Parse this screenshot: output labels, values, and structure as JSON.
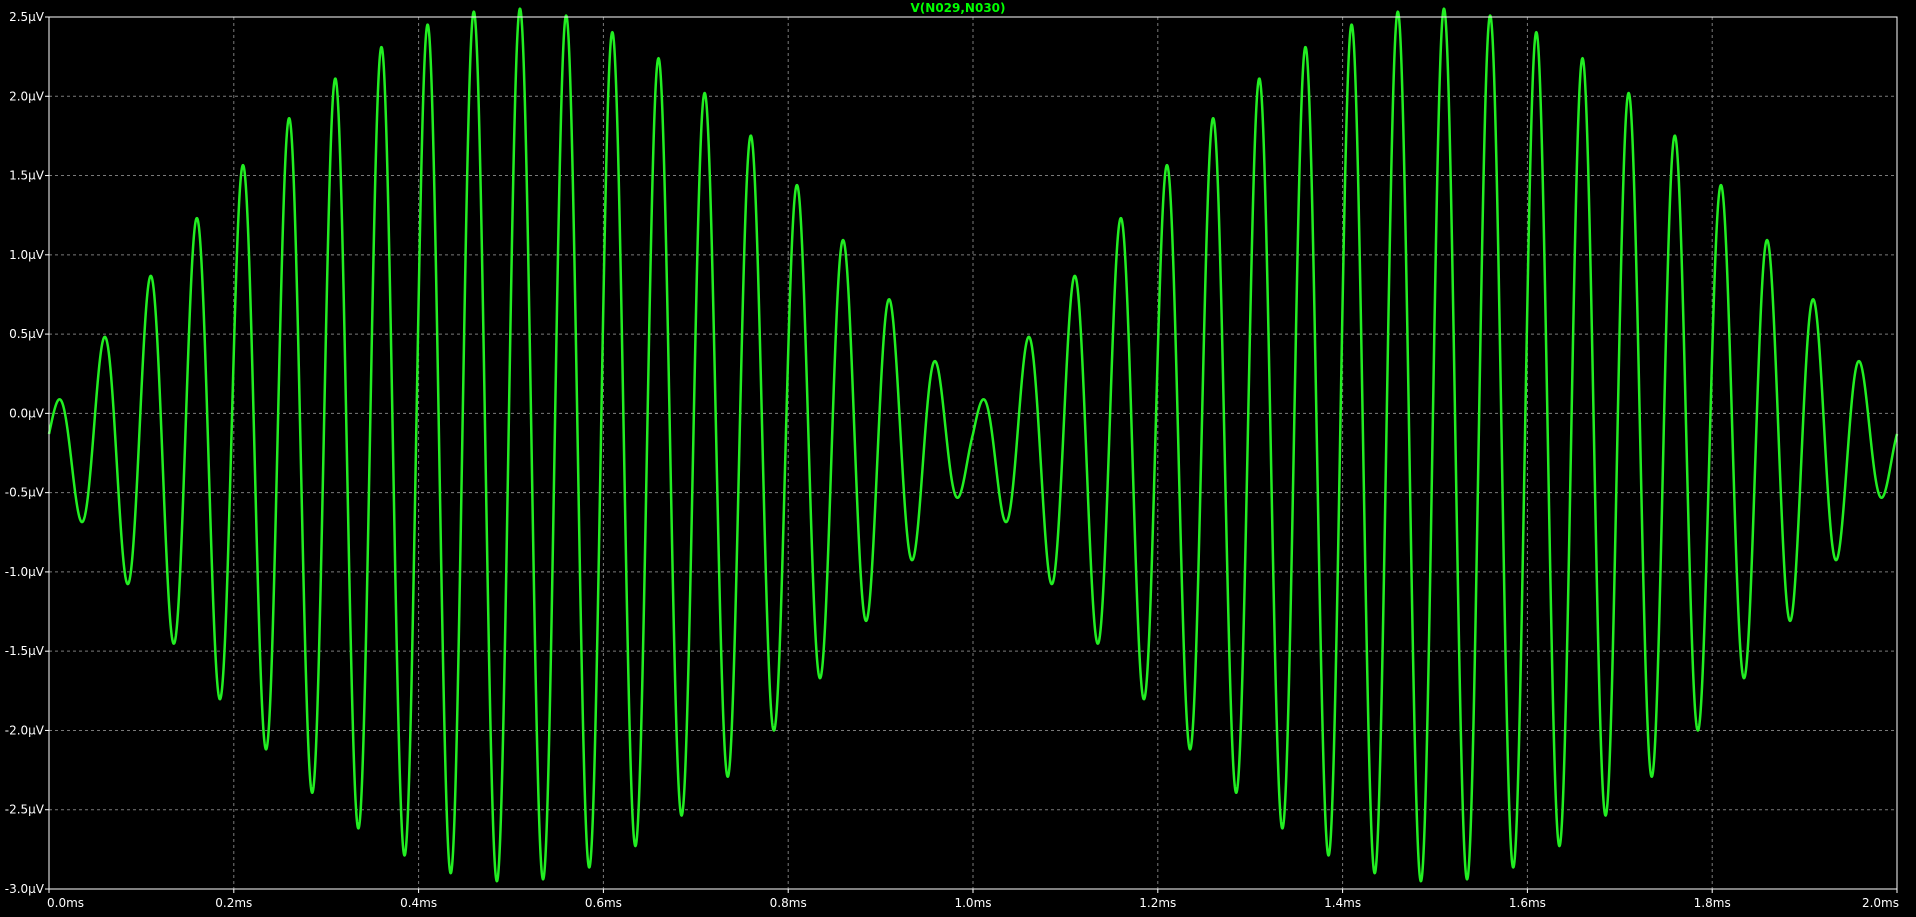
{
  "window": {
    "trace_label": "V(N029,N030)"
  },
  "colors": {
    "background": "#000000",
    "trace": "#22ee22",
    "grid": "#7a7a7a",
    "axis_text": "#ffffff",
    "frame": "#ffffff"
  },
  "chart_data": {
    "type": "line",
    "title": "V(N029,N030)",
    "xlabel": "",
    "ylabel": "",
    "xlim": [
      0.0,
      2.0
    ],
    "ylim": [
      -3.0,
      2.5
    ],
    "x_ticks": [
      0.0,
      0.2,
      0.4,
      0.6,
      0.8,
      1.0,
      1.2,
      1.4,
      1.6,
      1.8,
      2.0
    ],
    "x_tick_labels": [
      "0.0ms",
      "0.2ms",
      "0.4ms",
      "0.6ms",
      "0.8ms",
      "1.0ms",
      "1.2ms",
      "1.4ms",
      "1.6ms",
      "1.8ms",
      "2.0ms"
    ],
    "y_ticks": [
      2.5,
      2.0,
      1.5,
      1.0,
      0.5,
      0.0,
      -0.5,
      -1.0,
      -1.5,
      -2.0,
      -2.5,
      -3.0
    ],
    "y_tick_labels": [
      "2.5µV",
      "2.0µV",
      "1.5µV",
      "1.0µV",
      "0.5µV",
      "0.0µV",
      "-0.5µV",
      "-1.0µV",
      "-1.5µV",
      "-2.0µV",
      "-2.5µV",
      "-3.0µV"
    ],
    "grid": true,
    "series": [
      {
        "name": "V(N029,N030)",
        "description_model": "amplitude-modulated sinusoid: carrier ~20 kHz, envelope |sin| with 1 ms period, peak ≈ 2.55 µV, offset ≈ -0.2 µV",
        "carrier_khz": 20,
        "envelope_period_ms": 1.0,
        "peak_uV": 2.55,
        "offset_uV": -0.2
      }
    ]
  }
}
